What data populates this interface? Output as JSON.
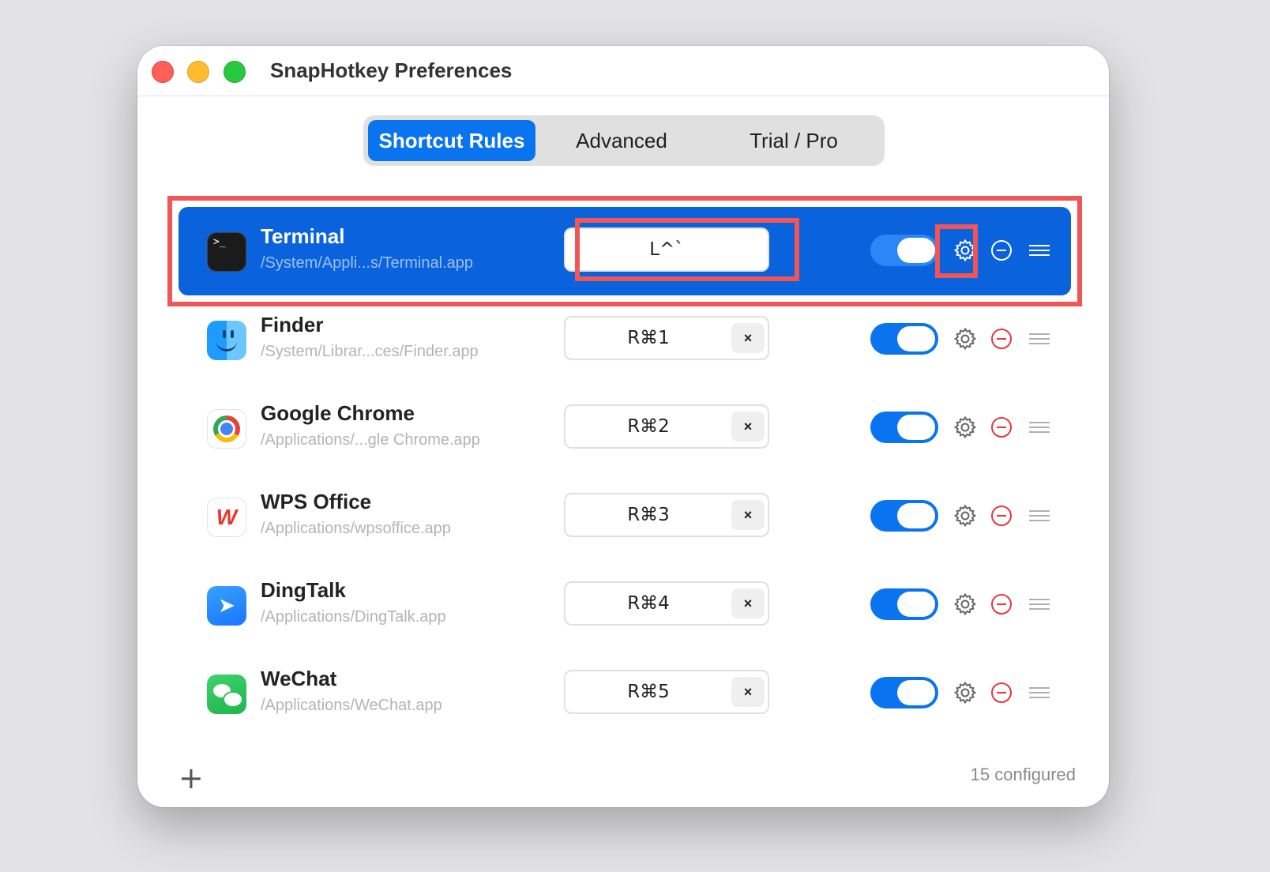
{
  "window": {
    "title": "SnapHotkey Preferences"
  },
  "tabs": [
    {
      "label": "Shortcut Rules",
      "active": true
    },
    {
      "label": "Advanced",
      "active": false
    },
    {
      "label": "Trial / Pro",
      "active": false
    }
  ],
  "rules": [
    {
      "name": "Terminal",
      "path": "/System/Appli...s/Terminal.app",
      "hotkey": "L^`",
      "enabled": true,
      "selected": true,
      "icon": "terminal-icon"
    },
    {
      "name": "Finder",
      "path": "/System/Librar...ces/Finder.app",
      "hotkey": "R⌘1",
      "enabled": true,
      "selected": false,
      "icon": "finder-icon"
    },
    {
      "name": "Google Chrome",
      "path": "/Applications/...gle Chrome.app",
      "hotkey": "R⌘2",
      "enabled": true,
      "selected": false,
      "icon": "chrome-icon"
    },
    {
      "name": "WPS Office",
      "path": "/Applications/wpsoffice.app",
      "hotkey": "R⌘3",
      "enabled": true,
      "selected": false,
      "icon": "wps-icon"
    },
    {
      "name": "DingTalk",
      "path": "/Applications/DingTalk.app",
      "hotkey": "R⌘4",
      "enabled": true,
      "selected": false,
      "icon": "dingtalk-icon"
    },
    {
      "name": "WeChat",
      "path": "/Applications/WeChat.app",
      "hotkey": "R⌘5",
      "enabled": true,
      "selected": false,
      "icon": "wechat-icon"
    }
  ],
  "clear_label": "×",
  "footer": {
    "add_label": "+",
    "status": "15 configured"
  },
  "colors": {
    "accent": "#0a74f0",
    "selected_row": "#0a63dd",
    "remove": "#e5383b",
    "highlight": "#f25555"
  }
}
